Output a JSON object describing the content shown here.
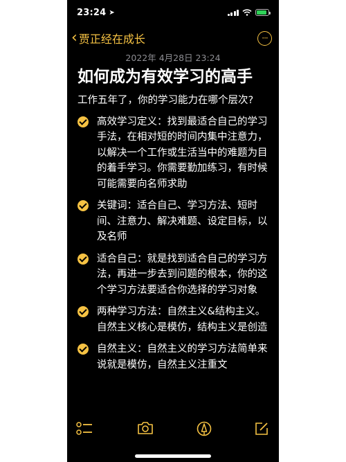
{
  "status_bar": {
    "time": "23:24",
    "location_icon": "location-arrow-icon",
    "battery_color": "#2fd158"
  },
  "nav": {
    "back_label": "贾正经在成长",
    "accent_color": "#f6c243"
  },
  "note": {
    "date": "2022年 4月28日 23:24",
    "title": "如何成为有效学习的高手",
    "intro": "工作五年了，你的学习能力在哪个层次?",
    "items": [
      {
        "text": "高效学习定义：找到最适合自己的学习手法，在相对短的时间内集中注意力，以解决一个工作或生活当中的难题为目的着手学习。你需要勤加练习，有时候可能需要向名师求助",
        "checked": true
      },
      {
        "text": "关键词：适合自己、学习方法、短时间、注意力、解决难题、设定目标，以及名师",
        "checked": true
      },
      {
        "text": "适合自己：就是找到适合自己的学习方法，再进一步去到问题的根本，你的这个学习方法要适合你选择的学习对象",
        "checked": true
      },
      {
        "text": "两种学习方法：自然主义&结构主义。自然主义核心是模仿，结构主义是创造",
        "checked": true
      },
      {
        "text": "自然主义：自然主义的学习方法简单来说就是模仿，自然主义注重文",
        "checked": true
      }
    ]
  },
  "toolbar": {
    "icons": [
      "checklist-icon",
      "camera-icon",
      "markup-pen-icon",
      "compose-icon"
    ]
  }
}
